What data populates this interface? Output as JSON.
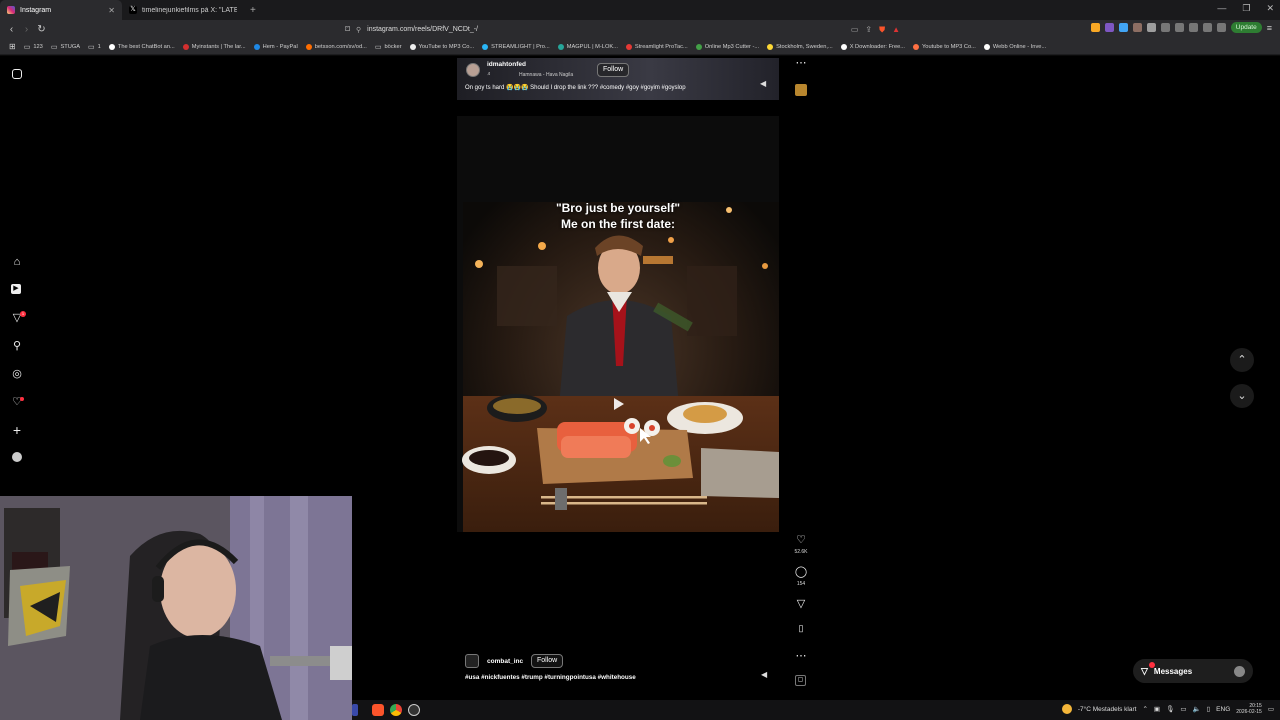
{
  "browser": {
    "tabs": [
      {
        "label": "Instagram",
        "active": true,
        "color": "#e1306c"
      },
      {
        "label": "timelinejunkiefilms på X: \"LATE ANTI",
        "active": false,
        "color": "#000000"
      }
    ],
    "url": "instagram.com/reels/DRfV_NCDt_-/",
    "update_label": "Update",
    "bookmarks": [
      {
        "label": "123",
        "icon": "folder-icon"
      },
      {
        "label": "STUGA",
        "icon": "folder-icon"
      },
      {
        "label": "1",
        "icon": "folder-icon"
      },
      {
        "label": "The best ChatBot an...",
        "icon": "site-icon",
        "color": "#ffffff"
      },
      {
        "label": "Myinstants | The lar...",
        "icon": "site-icon",
        "color": "#d32f2f"
      },
      {
        "label": "Hem - PayPal",
        "icon": "site-icon",
        "color": "#1e88e5"
      },
      {
        "label": "betsson.com/sv/od...",
        "icon": "site-icon",
        "color": "#ff6d00"
      },
      {
        "label": "böcker",
        "icon": "folder-icon"
      },
      {
        "label": "YouTube to MP3 Co...",
        "icon": "site-icon",
        "color": "#eeeeee"
      },
      {
        "label": "STREAMLIGHT | Pro...",
        "icon": "site-icon",
        "color": "#29b6f6"
      },
      {
        "label": "MAGPUL | M-LOK...",
        "icon": "site-icon",
        "color": "#26a69a"
      },
      {
        "label": "Streamlight ProTac...",
        "icon": "site-icon",
        "color": "#e53935"
      },
      {
        "label": "Online Mp3 Cutter -...",
        "icon": "site-icon",
        "color": "#43a047"
      },
      {
        "label": "Stockholm, Sweden,...",
        "icon": "site-icon",
        "color": "#fdd835"
      },
      {
        "label": "X Downloader: Free...",
        "icon": "site-icon",
        "color": "#ffffff"
      },
      {
        "label": "Youtube to MP3 Co...",
        "icon": "site-icon",
        "color": "#ff7043"
      },
      {
        "label": "Webb Online - Inve...",
        "icon": "site-icon",
        "color": "#ffffff"
      }
    ]
  },
  "instagram": {
    "nav_badge": "1",
    "prev_reel": {
      "handle": "idmahtonfed",
      "audio": "Hamnawa - Hava Nagila",
      "follow": "Follow",
      "caption": "On goy ts hard 😭😭😭 Should I drop the link ??? #comedy #goy #goyim #goyslop"
    },
    "reel": {
      "caption_line1": "\"Bro just be yourself\"",
      "caption_line2": "Me on the first date:",
      "handle": "combat_inc",
      "follow": "Follow",
      "tags": "#usa #nickfuentes #trump #turningpointusa #whitehouse",
      "likes": "52.6K",
      "comments": "154"
    },
    "messages_label": "Messages"
  },
  "taskbar": {
    "weather": "-7°C Mestadels klart",
    "lang": "ENG",
    "time": "20:15",
    "date": "2026-02-15"
  }
}
